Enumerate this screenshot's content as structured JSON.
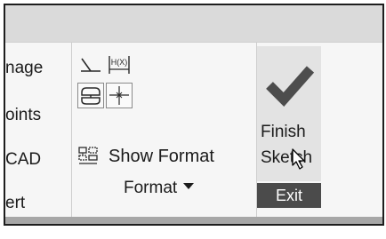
{
  "window": {
    "title": ""
  },
  "left_group": {
    "items": [
      {
        "label": "nage"
      },
      {
        "label": "oints"
      },
      {
        "label": "CAD"
      },
      {
        "label": "ert"
      }
    ]
  },
  "format_group": {
    "tools": [
      {
        "icon": "display-constraints-icon"
      },
      {
        "icon": "display-dimensions-icon"
      },
      {
        "icon": "show-overconstrained-icon"
      },
      {
        "icon": "snap-to-grid-icon"
      }
    ],
    "show_format": {
      "icon": "show-format-icon",
      "label": "Show Format"
    },
    "label": "Format"
  },
  "exit_group": {
    "finish": {
      "icon": "checkmark-icon",
      "label_line1": "Finish",
      "label_line2": "Sketch"
    },
    "label": "Exit"
  },
  "colors": {
    "titlebar": "#dadada",
    "ribbon": "#f6f6f6",
    "exit_label_bg": "#4b4b4b",
    "checkmark": "#4d4d4d"
  }
}
